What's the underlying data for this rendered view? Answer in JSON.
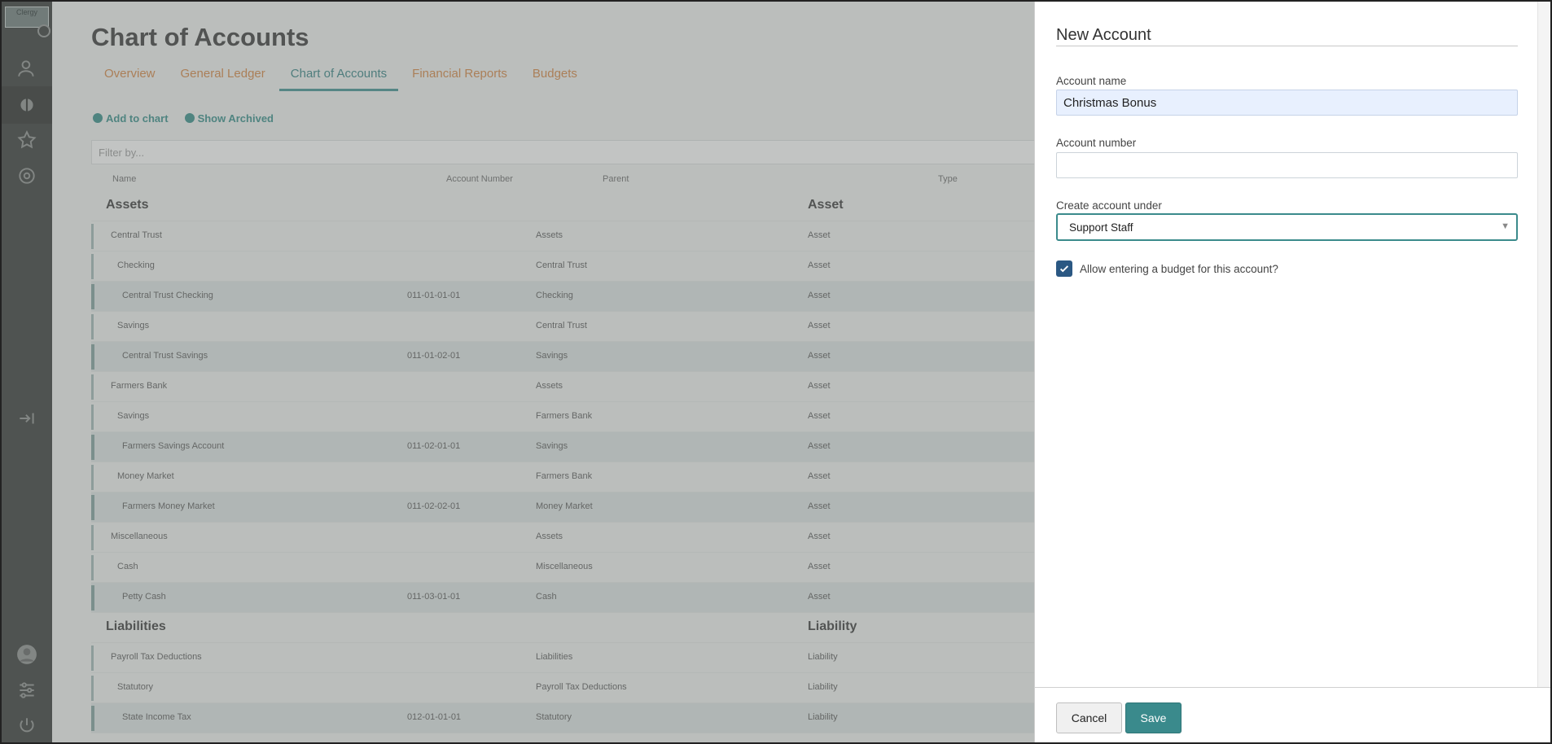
{
  "app": {
    "logo_text": "Clergy"
  },
  "page": {
    "title": "Chart of Accounts",
    "tabs": [
      {
        "label": "Overview"
      },
      {
        "label": "General Ledger"
      },
      {
        "label": "Chart of Accounts",
        "active": true
      },
      {
        "label": "Financial Reports"
      },
      {
        "label": "Budgets"
      }
    ],
    "actions": {
      "add_label": "Add to chart",
      "archived_label": "Show Archived"
    },
    "filter_placeholder": "Filter by...",
    "columns": [
      "Name",
      "Account Number",
      "Parent",
      "Type"
    ],
    "rows": [
      {
        "name": "Assets",
        "number": "",
        "parent": "",
        "type": "Asset"
      },
      {
        "name": "Central Trust",
        "number": "",
        "parent": "Assets",
        "type": "Asset"
      },
      {
        "name": "Checking",
        "number": "",
        "parent": "Central Trust",
        "type": "Asset"
      },
      {
        "name": "Central Trust Checking",
        "number": "011-01-01-01",
        "parent": "Checking",
        "type": "Asset"
      },
      {
        "name": "Savings",
        "number": "",
        "parent": "Central Trust",
        "type": "Asset"
      },
      {
        "name": "Central Trust Savings",
        "number": "011-01-02-01",
        "parent": "Savings",
        "type": "Asset"
      },
      {
        "name": "Farmers Bank",
        "number": "",
        "parent": "Assets",
        "type": "Asset"
      },
      {
        "name": "Savings",
        "number": "",
        "parent": "Farmers Bank",
        "type": "Asset"
      },
      {
        "name": "Farmers Savings Account",
        "number": "011-02-01-01",
        "parent": "Savings",
        "type": "Asset"
      },
      {
        "name": "Money Market",
        "number": "",
        "parent": "Farmers Bank",
        "type": "Asset"
      },
      {
        "name": "Farmers Money Market",
        "number": "011-02-02-01",
        "parent": "Money Market",
        "type": "Asset"
      },
      {
        "name": "Miscellaneous",
        "number": "",
        "parent": "Assets",
        "type": "Asset"
      },
      {
        "name": "Cash",
        "number": "",
        "parent": "Miscellaneous",
        "type": "Asset"
      },
      {
        "name": "Petty Cash",
        "number": "011-03-01-01",
        "parent": "Cash",
        "type": "Asset"
      },
      {
        "name": "Liabilities",
        "number": "",
        "parent": "",
        "type": "Liability"
      },
      {
        "name": "Payroll Tax Deductions",
        "number": "",
        "parent": "Liabilities",
        "type": "Liability"
      },
      {
        "name": "Statutory",
        "number": "",
        "parent": "Payroll Tax Deductions",
        "type": "Liability"
      },
      {
        "name": "State Income Tax",
        "number": "012-01-01-01",
        "parent": "Statutory",
        "type": "Liability"
      }
    ]
  },
  "dialog": {
    "title": "New Account",
    "account_name_label": "Account name",
    "account_name_value": "Christmas Bonus",
    "account_number_label": "Account number",
    "account_number_value": "",
    "parent_label": "Create account under",
    "parent_value": "Support Staff",
    "budget_checkbox_label": "Allow entering a budget for this account?",
    "budget_checked": true,
    "cancel_label": "Cancel",
    "save_label": "Save"
  },
  "colors": {
    "accent": "#3a8a8c",
    "tab_link": "#d5823c",
    "checkbox": "#2b5883",
    "rail": "#2f3230"
  }
}
